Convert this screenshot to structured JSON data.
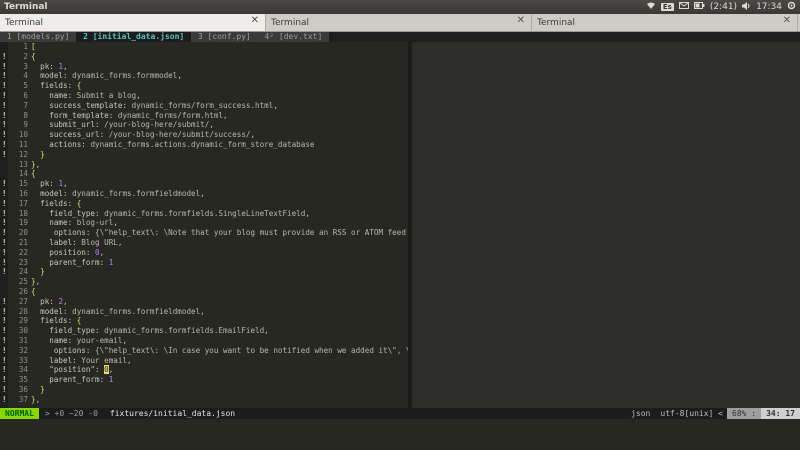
{
  "panel": {
    "app_title": "Terminal",
    "keyboard_indicator": "Es",
    "battery": "(2:41)",
    "clock": "17:34"
  },
  "terminal_tabs": [
    {
      "label": "Terminal"
    },
    {
      "label": "Terminal"
    },
    {
      "label": "Terminal"
    }
  ],
  "vim_tabs": [
    {
      "label": " 1 [models.py] "
    },
    {
      "label": " 2 [initial_data.json] "
    },
    {
      "label": " 3 [conf.py] "
    },
    {
      "label": " 4² [dev.txt] "
    }
  ],
  "code_lines": [
    {
      "n": "1",
      "sign": "",
      "html": "<span class='p'>[</span>"
    },
    {
      "n": "2",
      "sign": "!",
      "html": "<span class='p'>{</span>"
    },
    {
      "n": "3",
      "sign": "!",
      "html": "  pk: <span class='n'>1</span>,"
    },
    {
      "n": "4",
      "sign": "!",
      "html": "  model: <span class='s'>dynamic_forms.formmodel</span>,"
    },
    {
      "n": "5",
      "sign": "!",
      "html": "  fields: <span class='p'>{</span>"
    },
    {
      "n": "6",
      "sign": "!",
      "html": "    name: <span class='s'>Submit a blog</span>,"
    },
    {
      "n": "7",
      "sign": "!",
      "html": "    success_template: <span class='s'>dynamic_forms/form_success.html</span>,"
    },
    {
      "n": "8",
      "sign": "!",
      "html": "    form_template: <span class='s'>dynamic_forms/form.html</span>,"
    },
    {
      "n": "9",
      "sign": "!",
      "html": "    submit_url: <span class='s'>/your-blog-here/submit/</span>,"
    },
    {
      "n": "10",
      "sign": "!",
      "html": "    success_url: <span class='s'>/your-blog-here/submit/success/</span>,"
    },
    {
      "n": "11",
      "sign": "!",
      "html": "    actions: <span class='s'>dynamic_forms.actions.dynamic_form_store_database</span>"
    },
    {
      "n": "12",
      "sign": "!",
      "html": "  <span class='p'>}</span>"
    },
    {
      "n": "13",
      "sign": "",
      "html": "<span class='p'>}</span>,"
    },
    {
      "n": "14",
      "sign": "",
      "html": "<span class='p'>{</span>"
    },
    {
      "n": "15",
      "sign": "!",
      "html": "  pk: <span class='n'>1</span>,"
    },
    {
      "n": "16",
      "sign": "!",
      "html": "  model: <span class='s'>dynamic_forms.formfieldmodel</span>,"
    },
    {
      "n": "17",
      "sign": "!",
      "html": "  fields: <span class='p'>{</span>"
    },
    {
      "n": "18",
      "sign": "!",
      "html": "    field_type: <span class='s'>dynamic_forms.formfields.SingleLineTextField</span>,"
    },
    {
      "n": "19",
      "sign": "!",
      "html": "    name: <span class='s'>blog-url</span>,"
    },
    {
      "n": "20",
      "sign": "!",
      "html": "     options: <span class='s'>{\\\"help_text\\: \\Note that your blog must provide an RSS or ATOM feed for all posts about Django or related to it. \\\", \\\"required\\: true}\"</span>,<span class='err'>]</span>"
    },
    {
      "n": "21",
      "sign": "!",
      "html": "    label: <span class='s'>Blog URL</span>,"
    },
    {
      "n": "22",
      "sign": "!",
      "html": "    position: <span class='n'>0</span>,"
    },
    {
      "n": "23",
      "sign": "!",
      "html": "    parent_form: <span class='n'>1</span>"
    },
    {
      "n": "24",
      "sign": "!",
      "html": "  <span class='p'>}</span>"
    },
    {
      "n": "25",
      "sign": "",
      "html": "<span class='p'>}</span>,"
    },
    {
      "n": "26",
      "sign": "",
      "html": "<span class='p'>{</span>"
    },
    {
      "n": "27",
      "sign": "!",
      "html": "  pk: <span class='n'>2</span>,"
    },
    {
      "n": "28",
      "sign": "!",
      "html": "  model: <span class='s'>dynamic_forms.formfieldmodel</span>,"
    },
    {
      "n": "29",
      "sign": "!",
      "html": "  fields: <span class='p'>{</span>"
    },
    {
      "n": "30",
      "sign": "!",
      "html": "    field_type: <span class='s'>dynamic_forms.formfields.EmailField</span>,"
    },
    {
      "n": "31",
      "sign": "!",
      "html": "    name: <span class='s'>your-email</span>,"
    },
    {
      "n": "32",
      "sign": "!",
      "html": "     options: <span class='s'>{\\\"help_text\\: \\In case you want to be notified when we added it\\\", \\\"required\\: false}\"</span>,"
    },
    {
      "n": "33",
      "sign": "!",
      "html": "    label: <span class='s'>Your email</span>,"
    },
    {
      "n": "34",
      "sign": "!",
      "html": "    \"position\": <span class='cursor'>0</span>,"
    },
    {
      "n": "35",
      "sign": "!",
      "html": "    parent_form: <span class='n'>1</span>"
    },
    {
      "n": "36",
      "sign": "!",
      "html": "  <span class='p'>}</span>"
    },
    {
      "n": "37",
      "sign": "!",
      "html": "<span class='p'>}</span>,"
    }
  ],
  "statusline": {
    "mode": "NORMAL",
    "git_diff": "> +0 ~20 -0",
    "filename": "fixtures/initial_data.json",
    "filetype": "json",
    "encoding": "utf-8[unix] <",
    "percent": "68% :",
    "position": "34: 17"
  }
}
